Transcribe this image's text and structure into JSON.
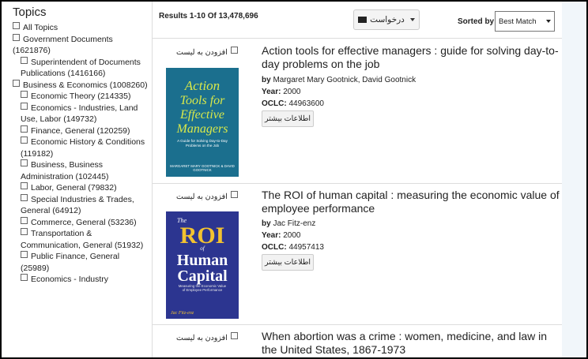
{
  "sidebar": {
    "heading": "Topics",
    "items": [
      {
        "label": "All Topics"
      },
      {
        "label": "Government Documents (1621876)"
      },
      {
        "label": "Superintendent of Documents Publications (1416166)"
      },
      {
        "label": "Business & Economics (1008260)"
      },
      {
        "label": "Economic Theory (214335)"
      },
      {
        "label": "Economics - Industries, Land Use, Labor (149732)"
      },
      {
        "label": "Finance, General (120259)"
      },
      {
        "label": "Economic History & Conditions (119182)"
      },
      {
        "label": "Business, Business Administration (102445)"
      },
      {
        "label": "Labor, General (79832)"
      },
      {
        "label": "Special Industries & Trades, General (64912)"
      },
      {
        "label": "Commerce, General (53236)"
      },
      {
        "label": "Transportation & Communication, General (51932)"
      },
      {
        "label": "Public Finance, General (25989)"
      },
      {
        "label": "Economics - Industry"
      }
    ]
  },
  "toolbar": {
    "results_text": "Results 1-10 Of 13,478,696",
    "request_label": "درخواست",
    "sorted_label": "Sorted by:",
    "sort_value": "Best Match"
  },
  "results": [
    {
      "add_label": "افزودن به لیست",
      "title": "Action tools for effective managers : guide for solving day-to-day problems on the job",
      "author_prefix": "by",
      "authors": "Margaret Mary Gootnick, David Gootnick",
      "year_label": "Year:",
      "year": "2000",
      "oclc_label": "OCLC:",
      "oclc": "44963600",
      "more_label": "اطلاعات بیشتر",
      "cover": {
        "line1": "Action",
        "line2": "Tools for",
        "line3": "Effective",
        "line4": "Managers",
        "subtitle": "A Guide for Solving Day-to-Day Problems on the Job",
        "authors": "Margaret Mary Gootnick & David Gootnick"
      }
    },
    {
      "add_label": "افزودن به لیست",
      "title": "The ROI of human capital : measuring the economic value of employee performance",
      "author_prefix": "by",
      "authors": "Jac Fitz-enz",
      "year_label": "Year:",
      "year": "2000",
      "oclc_label": "OCLC:",
      "oclc": "44957413",
      "more_label": "اطلاعات بیشتر",
      "cover": {
        "the": "The",
        "roi": "ROI",
        "of": "of",
        "human": "Human",
        "capital": "Capital",
        "subtitle": "Measuring the Economic Value of Employee Performance",
        "author": "Jac Fitz-enz"
      }
    },
    {
      "add_label": "افزودن به لیست",
      "title": "When abortion was a crime : women, medicine, and law in the United States, 1867-1973"
    }
  ],
  "colors": {
    "cover1_bg": "#1b6f8e",
    "cover1_text": "#d8e84a",
    "cover2_bg": "#2c3590",
    "cover2_title": "#f2c230",
    "right_band": "#f1f6fa"
  }
}
